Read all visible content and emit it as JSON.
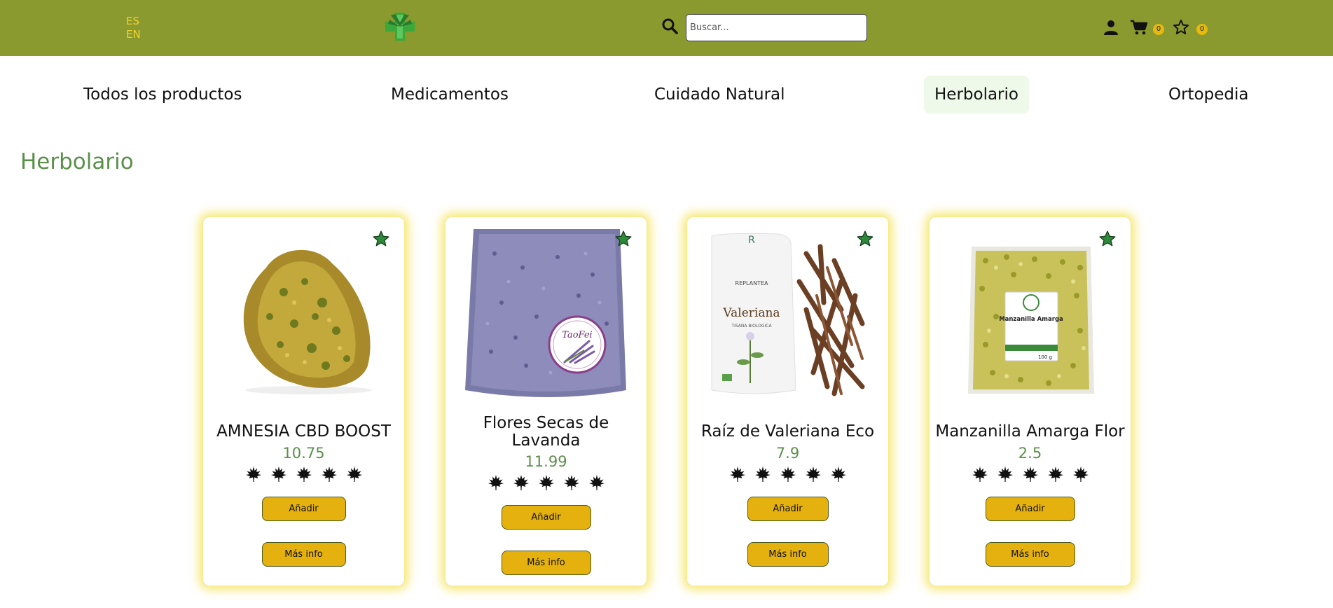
{
  "header": {
    "languages": [
      "ES",
      "EN"
    ],
    "logo_icon": "pharmacy-cross-icon",
    "search": {
      "placeholder": "Buscar...",
      "value": "",
      "icon": "search-icon"
    },
    "user_icon": "user-icon",
    "cart": {
      "icon": "cart-icon",
      "count": "0"
    },
    "favorites": {
      "icon": "star-outline-icon",
      "count": "0"
    }
  },
  "nav": {
    "items": [
      {
        "label": "Todos los productos",
        "active": false
      },
      {
        "label": "Medicamentos",
        "active": false
      },
      {
        "label": "Cuidado Natural",
        "active": false
      },
      {
        "label": "Herbolario",
        "active": true
      },
      {
        "label": "Ortopedia",
        "active": false
      }
    ]
  },
  "page": {
    "title": "Herbolario"
  },
  "products": [
    {
      "name": "AMNESIA CBD BOOST",
      "price": "10.75",
      "rating": 5,
      "image": "cannabis-bud-image",
      "add_label": "Añadir",
      "info_label": "Más info"
    },
    {
      "name": "Flores Secas de Lavanda",
      "price": "11.99",
      "rating": 5,
      "image": "lavender-bag-image",
      "image_label": "TaoFei",
      "add_label": "Añadir",
      "info_label": "Más info"
    },
    {
      "name": "Raíz de Valeriana Eco",
      "price": "7.9",
      "rating": 5,
      "image": "valerian-pouch-image",
      "image_label": "Valeriana",
      "image_label_brand": "REPLANTEA",
      "image_label_sub": "TISANA BIOLOGICA",
      "add_label": "Añadir",
      "info_label": "Más info"
    },
    {
      "name": "Manzanilla Amarga Flor",
      "price": "2.5",
      "rating": 5,
      "image": "chamomile-bag-image",
      "image_label": "Manzanilla Amarga",
      "add_label": "Añadir",
      "info_label": "Más info"
    }
  ],
  "colors": {
    "header_bg": "#8b9a2e",
    "accent_yellow": "#e4b10f",
    "title_green": "#5a8f4a",
    "active_nav_bg": "#eef9ea",
    "favorite_star": "#2e8a3a"
  }
}
